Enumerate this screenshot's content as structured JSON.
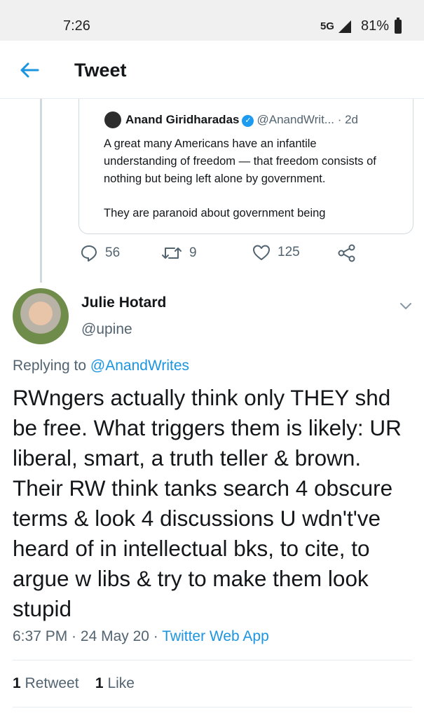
{
  "status_bar": {
    "time": "7:26",
    "network": "5G",
    "battery": "81%"
  },
  "header": {
    "title": "Tweet"
  },
  "quoted_tweet": {
    "name": "Anand Giridharadas",
    "handle": "@AnandWrit...",
    "age": "· 2d",
    "paragraph_1": "A great many Americans have an infantile understanding of freedom — that freedom consists of nothing but being left alone by government.",
    "paragraph_2": "They are paranoid about government being"
  },
  "parent_actions": {
    "replies": "56",
    "retweets": "9",
    "likes": "125"
  },
  "reply": {
    "name": "Julie Hotard",
    "handle": "@upine",
    "replying_prefix": "Replying to",
    "replying_to": "@AnandWrites",
    "text": "RWngers actually think only THEY shd be free. What triggers them is likely: UR liberal, smart, a truth teller & brown. Their RW think tanks search 4 obscure terms & look 4 discussions U wdn't've heard of in intellectual bks, to cite, to argue w libs & try to make them look stupid",
    "time": "6:37 PM",
    "date": "24 May 20",
    "source": "Twitter Web App",
    "retweet_count": "1",
    "retweet_label": "Retweet",
    "like_count": "1",
    "like_label": "Like"
  },
  "colors": {
    "accent": "#1b95e0",
    "verified": "#1d9bf0",
    "muted": "#536471"
  }
}
